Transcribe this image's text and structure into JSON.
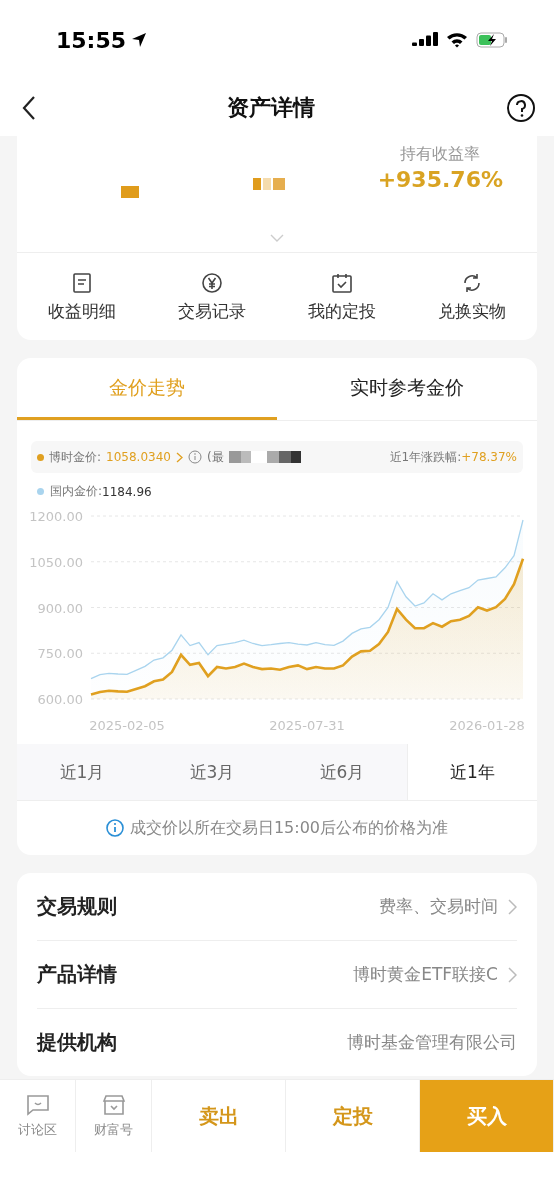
{
  "status_bar": {
    "time": "15:55"
  },
  "header": {
    "title": "资产详情"
  },
  "summary": {
    "rate_label": "持有收益率",
    "rate_value": "+935.76%"
  },
  "quick_actions": [
    {
      "label": "收益明细",
      "kind": "list"
    },
    {
      "label": "交易记录",
      "kind": "yen"
    },
    {
      "label": "我的定投",
      "kind": "calendar"
    },
    {
      "label": "兑换实物",
      "kind": "refresh"
    }
  ],
  "chart_card": {
    "tabs": [
      {
        "label": "金价走势",
        "selected": true
      },
      {
        "label": "实时参考金价",
        "selected": false
      }
    ],
    "legend": [
      {
        "value": "1058.0340",
        "suffix": "(最"
      },
      {
        "value": "1184.96"
      }
    ],
    "change_label": "近1年涨跌幅:",
    "change_value": "+78.37%",
    "chart_data": {
      "type": "area",
      "grid": true,
      "categories": [
        null,
        null,
        null,
        null,
        "2025-02-05",
        null,
        null,
        null,
        null,
        null,
        null,
        null,
        null,
        null,
        null,
        null,
        null,
        null,
        null,
        null,
        null,
        null,
        null,
        null,
        "2025-07-31",
        null,
        null,
        null,
        null,
        null,
        null,
        null,
        null,
        null,
        null,
        null,
        null,
        null,
        null,
        null,
        null,
        null,
        null,
        null,
        "2026-01-28",
        null,
        null,
        null,
        null
      ],
      "ylim": [
        600,
        1200
      ],
      "yticks": [
        {
          "value": 600,
          "label": "600.00"
        },
        {
          "value": 750,
          "label": "750.00"
        },
        {
          "value": 900,
          "label": "900.00"
        },
        {
          "value": 1050,
          "label": "1050.00"
        },
        {
          "value": 1200,
          "label": "1200.00"
        }
      ],
      "series": [
        {
          "name": "博时金价:",
          "color": "#e0a020",
          "values": [
            615,
            623,
            627,
            625,
            624,
            633,
            642,
            658,
            664,
            689,
            745,
            712,
            718,
            675,
            705,
            700,
            705,
            716,
            705,
            698,
            700,
            696,
            705,
            710,
            698,
            705,
            700,
            700,
            710,
            739,
            756,
            758,
            780,
            820,
            895,
            860,
            832,
            832,
            849,
            837,
            855,
            860,
            872,
            901,
            890,
            901,
            928,
            976,
            1060
          ]
        },
        {
          "name": "国内金价:",
          "color": "#a9d4ee",
          "values": [
            667,
            680,
            684,
            682,
            681,
            694,
            707,
            728,
            735,
            760,
            810,
            775,
            785,
            745,
            775,
            780,
            785,
            793,
            782,
            775,
            778,
            782,
            785,
            780,
            777,
            785,
            778,
            776,
            790,
            815,
            830,
            835,
            860,
            900,
            985,
            935,
            905,
            915,
            945,
            925,
            945,
            955,
            965,
            990,
            995,
            1000,
            1030,
            1070,
            1187
          ]
        }
      ]
    },
    "periods": [
      {
        "label": "近1月",
        "selected": false
      },
      {
        "label": "近3月",
        "selected": false
      },
      {
        "label": "近6月",
        "selected": false
      },
      {
        "label": "近1年",
        "selected": true
      }
    ],
    "notice": "成交价以所在交易日15:00后公布的价格为准"
  },
  "info_rows": [
    {
      "label": "交易规则",
      "value": "费率、交易时间",
      "arrow": true
    },
    {
      "label": "产品详情",
      "value": "博时黄金ETF联接C",
      "arrow": true
    },
    {
      "label": "提供机构",
      "value": "博时基金管理有限公司",
      "arrow": false
    }
  ],
  "bottom_bar": {
    "icon_buttons": [
      {
        "label": "讨论区",
        "kind": "chat"
      },
      {
        "label": "财富号",
        "kind": "store"
      }
    ],
    "actions": [
      {
        "label": "卖出",
        "kind": "outline"
      },
      {
        "label": "定投",
        "kind": "outline"
      },
      {
        "label": "买入",
        "kind": "primary"
      }
    ]
  }
}
